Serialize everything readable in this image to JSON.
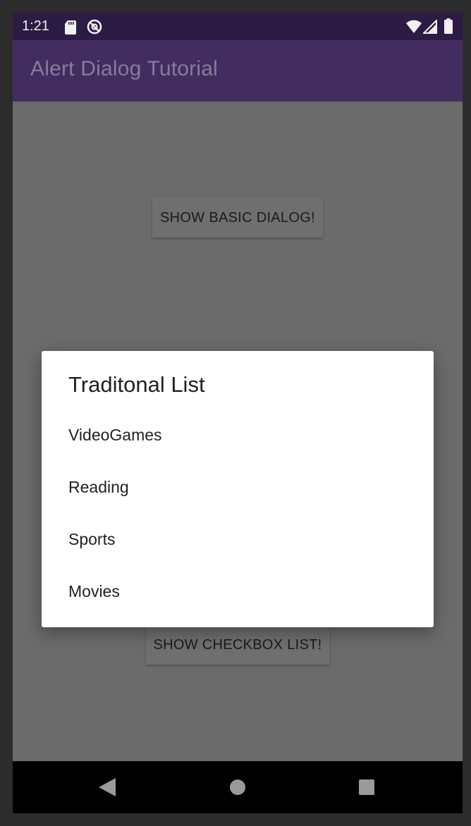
{
  "status_bar": {
    "time": "1:21",
    "icons": [
      "sd-card-icon",
      "no-signal-icon",
      "wifi-icon",
      "cell-signal-icon",
      "battery-icon"
    ]
  },
  "app_bar": {
    "title": "Alert Dialog Tutorial"
  },
  "main": {
    "basic_dialog_button": "SHOW BASIC DIALOG!",
    "checkbox_list_button": "SHOW CHECKBOX LIST!"
  },
  "dialog": {
    "title": "Traditonal List",
    "items": [
      {
        "label": "VideoGames"
      },
      {
        "label": "Reading"
      },
      {
        "label": "Sports"
      },
      {
        "label": "Movies"
      }
    ]
  },
  "nav_bar": {
    "icons": [
      "back-icon",
      "home-icon",
      "recents-icon"
    ]
  },
  "colors": {
    "status_bar": "#2b1b45",
    "app_bar": "#432c5f",
    "scrim": "#6b6b6b",
    "dialog_background": "#ffffff"
  }
}
